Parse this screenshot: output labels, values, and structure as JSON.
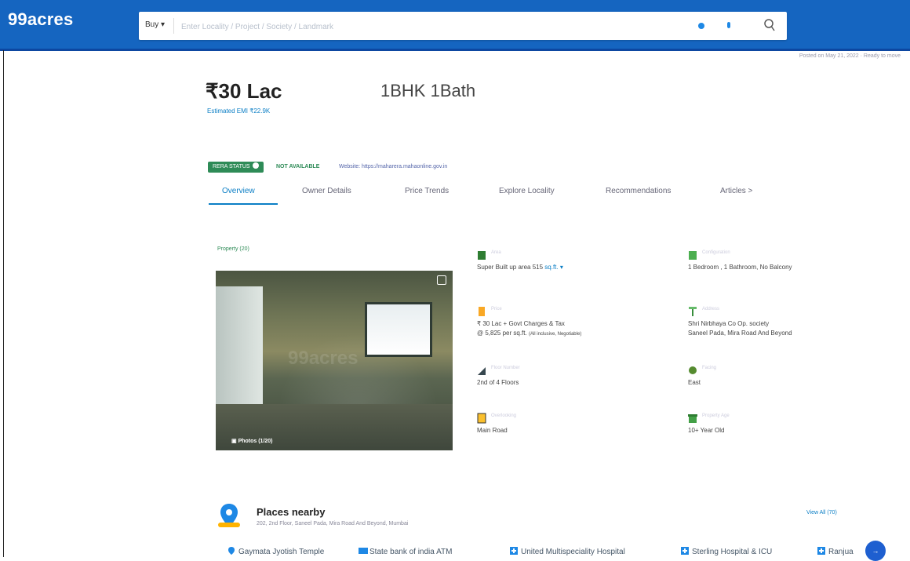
{
  "header": {
    "logo": "99acres",
    "buy_label": "Buy ▾",
    "search_placeholder": "Enter Locality / Project / Society / Landmark"
  },
  "posted": "Posted on May 21, 2022  ·  Ready to move",
  "listing": {
    "price": "₹30 Lac",
    "emi": "Estimated EMI ₹22.9K",
    "config": "1BHK 1Bath",
    "config_lines": [
      "",
      "",
      ""
    ]
  },
  "badges": {
    "rera": "RERA STATUS",
    "not_available": "NOT AVAILABLE",
    "website": "Website: https://maharera.mahaonline.gov.in"
  },
  "tabs": [
    "Overview",
    "Owner Details",
    "Price Trends",
    "Explore Locality",
    "Recommendations",
    "Articles >"
  ],
  "photo": {
    "label": "Property (20)",
    "count": "Photos (1/20)",
    "watermark": "99acres"
  },
  "features": [
    {
      "label": "Area",
      "line1": "Super Built up area 515 ",
      "unit": "sq.ft. ▾",
      "line2": ""
    },
    {
      "label": "Configuration",
      "line1": "1 Bedroom , 1 Bathroom, No Balcony",
      "unit": "",
      "line2": ""
    },
    {
      "label": "Price",
      "line1": "₹ 30 Lac + Govt Charges & Tax",
      "unit": "",
      "line2": "@ 5,825 per sq.ft.",
      "line2_small": "(All inclusive, Negotiable)"
    },
    {
      "label": "Address",
      "line1": "Shri Nirbhaya Co Op. society",
      "unit": "",
      "line2": "Saneel Pada, Mira Road And Beyond"
    },
    {
      "label": "Floor Number",
      "line1": "2nd  of 4 Floors",
      "unit": "",
      "line2": ""
    },
    {
      "label": "Facing",
      "line1": "East",
      "unit": "",
      "line2": ""
    },
    {
      "label": "Overlooking",
      "line1": "Main Road",
      "unit": "",
      "line2": ""
    },
    {
      "label": "Property Age",
      "line1": "10+ Year Old",
      "unit": "",
      "line2": ""
    }
  ],
  "places": {
    "title": "Places nearby",
    "address": "202, 2nd Floor, Saneel Pada, Mira Road And Beyond, Mumbai",
    "view_all": "View All (70)",
    "chips": [
      "Gaymata Jyotish Temple",
      "State bank of india ATM",
      "United Multispeciality Hospital",
      "Sterling Hospital & ICU",
      "Ranjua"
    ]
  },
  "colors": {
    "header_bg": "#1565c0",
    "accent": "#0b7ec5",
    "green": "#2e8b57"
  }
}
